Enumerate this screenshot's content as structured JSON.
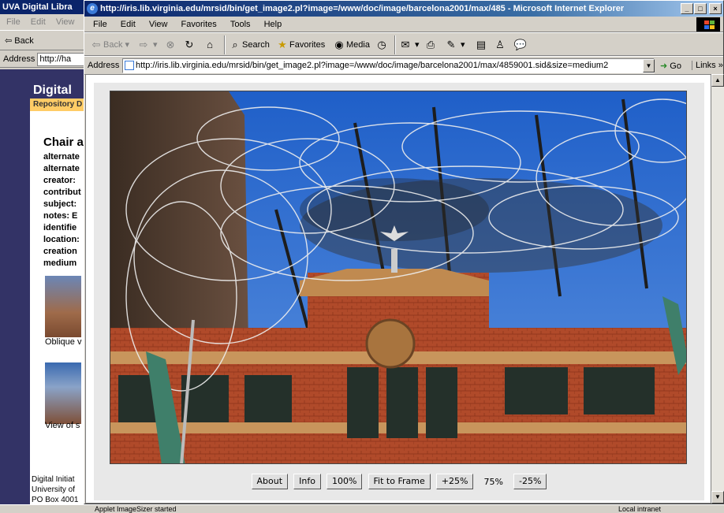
{
  "background_window": {
    "title": "UVA Digital Libra",
    "menu": [
      "File",
      "Edit",
      "View"
    ],
    "back_label": "Back",
    "address_label": "Address",
    "address_value": "http://ha",
    "brand_title": "Digital",
    "brand_subtitle": "Repository D",
    "record_title": "Chair a",
    "fields": [
      "alternate",
      "alternate",
      "creator:",
      "contribut",
      "subject:",
      "notes:  E",
      "identifie",
      "location:",
      "creation",
      "medium"
    ],
    "thumb_caption_1": "Oblique v",
    "thumb_caption_2": "View of s",
    "footer": [
      "Digital Initiat",
      "University of",
      "PO Box 4001"
    ]
  },
  "window": {
    "title": "http://iris.lib.virginia.edu/mrsid/bin/get_image2.pl?image=/www/doc/image/barcelona2001/max/485 - Microsoft Internet Explorer",
    "controls": [
      "_",
      "□",
      "×"
    ]
  },
  "menubar": [
    "File",
    "Edit",
    "View",
    "Favorites",
    "Tools",
    "Help"
  ],
  "toolbar": {
    "back": "Back",
    "search": "Search",
    "favorites": "Favorites",
    "media": "Media"
  },
  "addressbar": {
    "label": "Address",
    "url": "http://iris.lib.virginia.edu/mrsid/bin/get_image2.pl?image=/www/doc/image/barcelona2001/max/4859001.sid&size=medium2",
    "go": "Go",
    "links": "Links"
  },
  "viewer": {
    "buttons": {
      "about": "About",
      "info": "Info",
      "full": "100%",
      "fit": "Fit to Frame",
      "zoom_in": "+25%",
      "zoom_out": "-25%"
    },
    "zoom_level": "75%"
  },
  "status": {
    "text": "Applet ImageSizer started",
    "zone": "Local intranet"
  },
  "colors": {
    "title_bar": "#0a246a",
    "brand": "#333366",
    "sky": "#2f6ed1",
    "brick": "#b04a2a"
  }
}
